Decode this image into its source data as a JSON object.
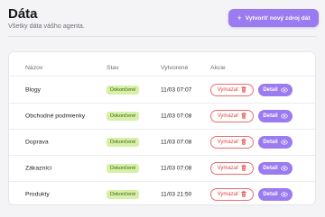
{
  "header": {
    "title": "Dáta",
    "subtitle": "Všetky dáta vášho agenta.",
    "create_button": "Vytvoriť nový zdroj dát"
  },
  "table": {
    "columns": [
      "Názov",
      "Stav",
      "Vytvorené",
      "Akcie"
    ],
    "delete_label": "Vymazať",
    "detail_label": "Detail",
    "rows": [
      {
        "name": "Blogy",
        "status": "Dokončené",
        "created": "11/03 07:07"
      },
      {
        "name": "Obchodné podmienky",
        "status": "Dokončené",
        "created": "11/03 07:08"
      },
      {
        "name": "Doprava",
        "status": "Dokončené",
        "created": "11/03 07:08"
      },
      {
        "name": "Zákazníci",
        "status": "Dokončené",
        "created": "11/03 07:08"
      },
      {
        "name": "Produkty",
        "status": "Dokončené",
        "created": "11/03 21:50"
      }
    ]
  },
  "colors": {
    "accent": "#9a7bf0",
    "danger": "#e14848",
    "success_bg": "#d7f0a8",
    "success_text": "#3f6214"
  },
  "icons": {
    "create": "plus-icon",
    "delete": "trash-icon",
    "detail": "eye-icon"
  }
}
